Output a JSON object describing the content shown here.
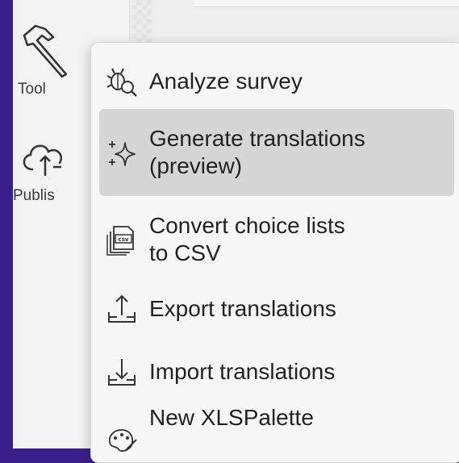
{
  "toolbar": {
    "tools_label": "Tool",
    "publish_label": "Publis"
  },
  "menu": {
    "items": [
      {
        "label": "Analyze survey",
        "icon": "bug-search-icon"
      },
      {
        "label": "Generate translations\n(preview)",
        "icon": "sparkle-icon"
      },
      {
        "label": "Convert choice lists\nto CSV",
        "icon": "csv-file-icon"
      },
      {
        "label": "Export translations",
        "icon": "export-icon"
      },
      {
        "label": "Import translations",
        "icon": "import-icon"
      },
      {
        "label": "New XLSPalette",
        "icon": "palette-icon"
      }
    ],
    "active_index": 1
  },
  "colors": {
    "background": "#3b1e8d",
    "menu": "#f7f7f7",
    "active": "#d6d6d6"
  }
}
